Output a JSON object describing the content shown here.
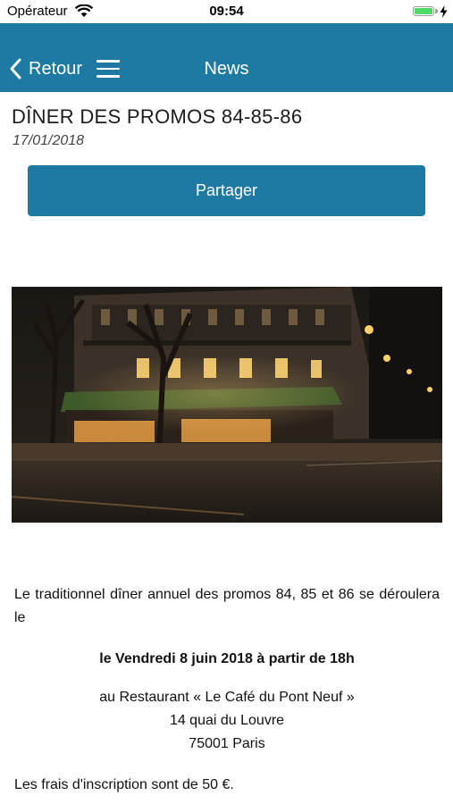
{
  "status_bar": {
    "carrier": "Opérateur",
    "time": "09:54",
    "battery_level": 1.0,
    "battery_color": "#4cd964"
  },
  "nav": {
    "back_label": "Retour",
    "title": "News",
    "background": "#1f7aa3",
    "back_icon": "chevron-left-icon",
    "menu_icon": "hamburger-menu-icon"
  },
  "article": {
    "title": "DÎNER DES PROMOS 84-85-86",
    "date": "17/01/2018",
    "share_label": "Partager",
    "photo": "night street café photograph",
    "intro": "Le traditionnel dîner annuel des promos 84, 85 et 86 se déroulera le",
    "event_date": "le Vendredi 8 juin 2018 à partir de 18h",
    "address_line1": "au Restaurant « Le Café du Pont Neuf »",
    "address_line2": "14 quai du Louvre",
    "address_line3": "75001 Paris",
    "fees": "Les frais d'inscription sont de 50 €."
  }
}
